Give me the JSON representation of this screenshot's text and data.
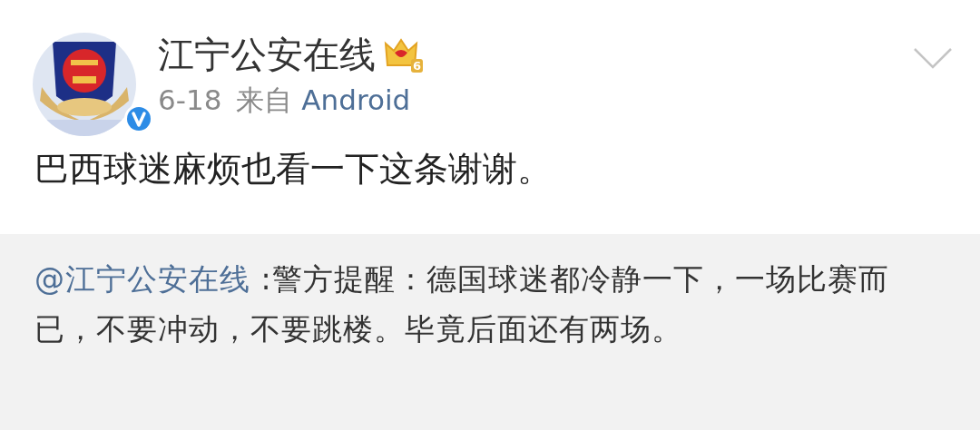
{
  "post": {
    "author": "江宁公安在线",
    "level_badge": "6",
    "verified": true,
    "date": "6-18",
    "source_prefix": "来自",
    "source": "Android",
    "text": "巴西球迷麻烦也看一下这条谢谢。"
  },
  "repost": {
    "author_link": "@江宁公安在线",
    "text": " :警方提醒：德国球迷都冷静一下，一场比赛而已，不要冲动，不要跳楼。毕竟后面还有两场。"
  }
}
